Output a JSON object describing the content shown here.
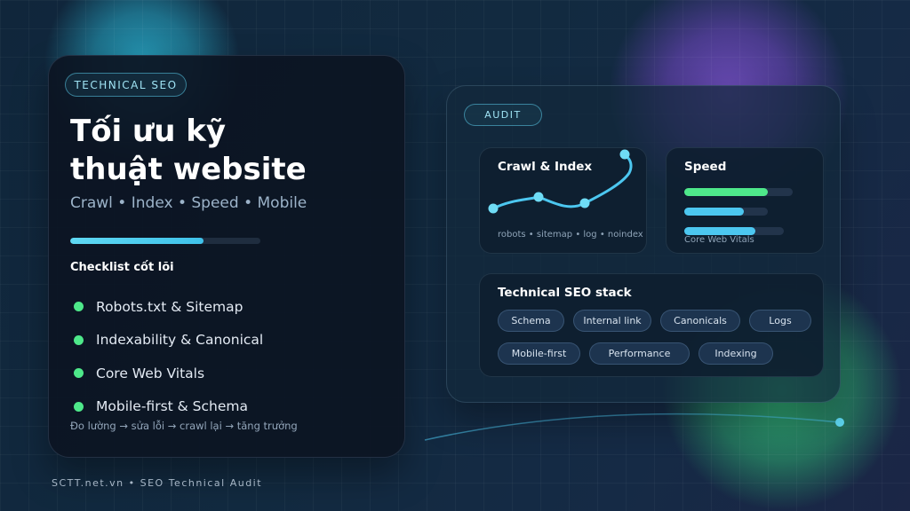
{
  "left_card": {
    "tag": "TECHNICAL SEO",
    "title_line1": "Tối ưu kỹ",
    "title_line2": "thuật website",
    "subtitle": "Crawl • Index • Speed • Mobile",
    "progress": 0.7,
    "checklist_heading": "Checklist cốt lõi",
    "checklist": [
      "Robots.txt & Sitemap",
      "Indexability & Canonical",
      "Core Web Vitals",
      "Mobile-first & Schema"
    ],
    "footer_note": "Đo lường → sửa lỗi → crawl lại → tăng trưởng"
  },
  "audit_card": {
    "tag": "AUDIT",
    "crawl": {
      "title": "Crawl & Index",
      "caption": "robots • sitemap • log • noindex"
    },
    "speed": {
      "title": "Speed",
      "caption": "Core Web Vitals",
      "bars": [
        {
          "value": 0.77,
          "color": "#4ee88a"
        },
        {
          "value": 0.71,
          "color": "#4cc7f0"
        },
        {
          "value": 0.71,
          "color": "#4cc7f0"
        }
      ]
    },
    "stack": {
      "title": "Technical SEO stack",
      "chips_row1": [
        "Schema",
        "Internal link",
        "Canonicals",
        "Logs"
      ],
      "chips_row2": [
        "Mobile-first",
        "Performance",
        "Indexing"
      ]
    }
  },
  "colors": {
    "accent_cyan": "#4cc7f0",
    "accent_green": "#4ee88a"
  },
  "brand": "SCTT.net.vn • SEO Technical Audit"
}
